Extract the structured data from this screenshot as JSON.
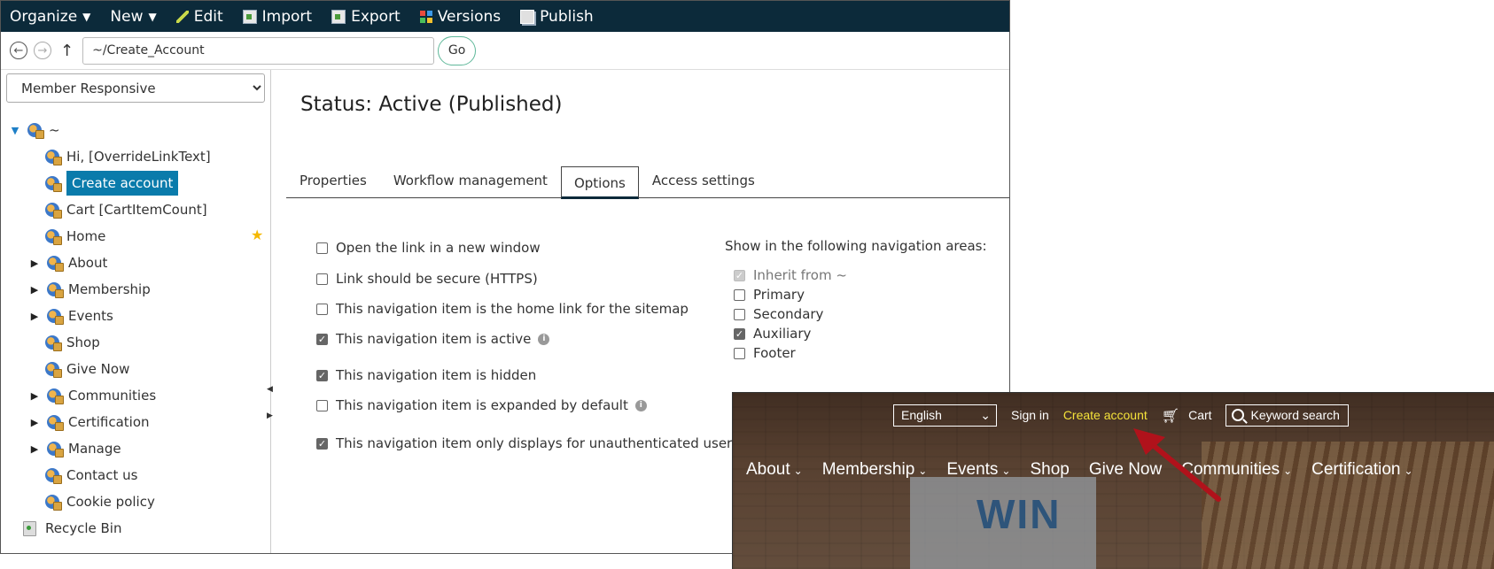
{
  "toolbar": {
    "organize": "Organize",
    "new": "New",
    "edit": "Edit",
    "import": "Import",
    "export": "Export",
    "versions": "Versions",
    "publish": "Publish"
  },
  "address": {
    "path": "~/Create_Account",
    "go": "Go"
  },
  "sidebar": {
    "site": "Member Responsive",
    "root": "~",
    "items": [
      {
        "label": "Hi, [OverrideLinkText]"
      },
      {
        "label": "Create account"
      },
      {
        "label": "Cart [CartItemCount]"
      },
      {
        "label": "Home"
      },
      {
        "label": "About"
      },
      {
        "label": "Membership"
      },
      {
        "label": "Events"
      },
      {
        "label": "Shop"
      },
      {
        "label": "Give Now"
      },
      {
        "label": "Communities"
      },
      {
        "label": "Certification"
      },
      {
        "label": "Manage"
      },
      {
        "label": "Contact us"
      },
      {
        "label": "Cookie policy"
      }
    ],
    "recycle": "Recycle Bin"
  },
  "main": {
    "status": "Status: Active (Published)",
    "tabs": [
      "Properties",
      "Workflow management",
      "Options",
      "Access settings"
    ],
    "options": [
      {
        "label": "Open the link in a new window",
        "checked": false
      },
      {
        "label": "Link should be secure (HTTPS)",
        "checked": false
      },
      {
        "label": "This navigation item is the home link for the sitemap",
        "checked": false
      },
      {
        "label": "This navigation item is active",
        "checked": true
      },
      {
        "label": "This navigation item is hidden",
        "checked": true
      },
      {
        "label": "This navigation item is expanded by default",
        "checked": false
      },
      {
        "label": "This navigation item only displays for unauthenticated users",
        "checked": true
      }
    ],
    "nav_areas_label": "Show in the following navigation areas:",
    "nav_areas": [
      {
        "label": "Inherit from ~",
        "checked": true,
        "disabled": true
      },
      {
        "label": "Primary",
        "checked": false
      },
      {
        "label": "Secondary",
        "checked": false
      },
      {
        "label": "Auxiliary",
        "checked": true
      },
      {
        "label": "Footer",
        "checked": false
      }
    ]
  },
  "preview": {
    "language": "English",
    "sign_in": "Sign in",
    "create_account": "Create account",
    "cart": "Cart",
    "search": "Keyword search",
    "nav": [
      "About",
      "Membership",
      "Events",
      "Shop",
      "Give Now",
      "Communities",
      "Certification"
    ],
    "sign_text": "WIN",
    "highlight_color": "#f4e23a",
    "arrow_color": "#b0121b"
  },
  "colors": {
    "topbar": "#0c2a3a",
    "selected": "#0a7bab",
    "go_border": "#5fb89a"
  }
}
